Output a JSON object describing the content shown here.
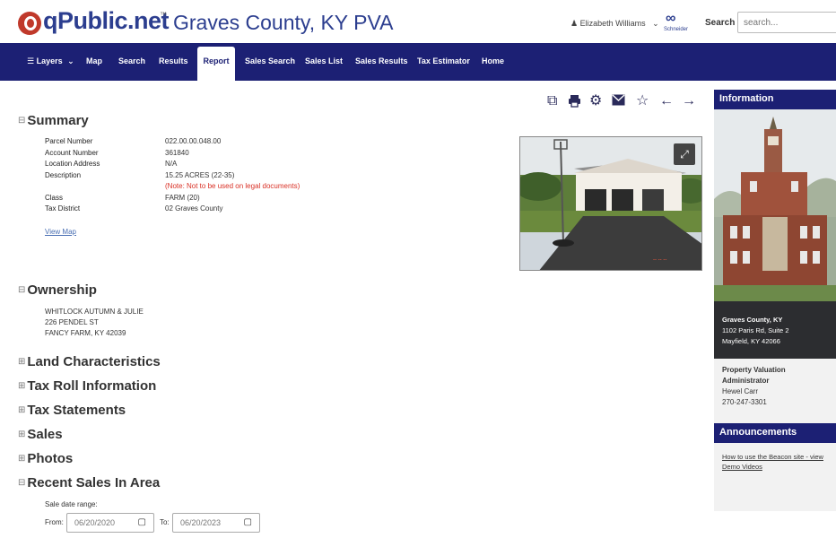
{
  "header": {
    "logo_text": "qPublic.net",
    "trademark": "™",
    "county_title": "Graves County, KY PVA",
    "user_name": "Elizabeth Williams",
    "vendor": "Schneider",
    "search_label": "Search",
    "search_placeholder": "search..."
  },
  "nav": {
    "items": [
      "Layers",
      "Map",
      "Search",
      "Results",
      "Report",
      "Sales Search",
      "Sales List",
      "Sales Results",
      "Tax Estimator",
      "Home"
    ],
    "active": "Report"
  },
  "summary": {
    "title": "Summary",
    "rows": [
      {
        "label": "Parcel Number",
        "value": "022.00.00.048.00"
      },
      {
        "label": "Account Number",
        "value": "361840"
      },
      {
        "label": "Location Address",
        "value": "N/A"
      },
      {
        "label": "Description",
        "value": "15.25 ACRES (22-35)"
      },
      {
        "label": "Class",
        "value": "FARM (20)"
      },
      {
        "label": "Tax District",
        "value": "02 Graves County"
      }
    ],
    "description_note": "(Note: Not to be used on legal documents)",
    "view_map": "View Map"
  },
  "ownership": {
    "title": "Ownership",
    "lines": [
      "WHITLOCK AUTUMN & JULIE",
      "226 PENDEL ST",
      "FANCY FARM, KY 42039"
    ]
  },
  "collapsed_sections": [
    "Land Characteristics",
    "Tax Roll Information",
    "Tax Statements",
    "Sales",
    "Photos"
  ],
  "recent_sales": {
    "title": "Recent Sales In Area",
    "range_label": "Sale date range:",
    "from_label": "From:",
    "from_value": "06/20/2020",
    "to_label": "To:",
    "to_value": "06/20/2023"
  },
  "sidebar": {
    "info_title": "Information",
    "office_name": "Graves County, KY",
    "office_street": "1102 Paris Rd, Suite 2",
    "office_city": "Mayfield, KY 42066",
    "pva_line1": "Property Valuation",
    "pva_line2": "Administrator",
    "pva_name": "Hewel Carr",
    "pva_phone": "270-247-3301",
    "announcements_title": "Announcements",
    "announcement_link_1": "How to use the Beacon site - view",
    "announcement_link_2": "Demo Videos"
  },
  "colors": {
    "navy": "#1c2074",
    "brand_blue": "#2c3e8f",
    "logo_red": "#c0392b",
    "note_red": "#d93025"
  }
}
